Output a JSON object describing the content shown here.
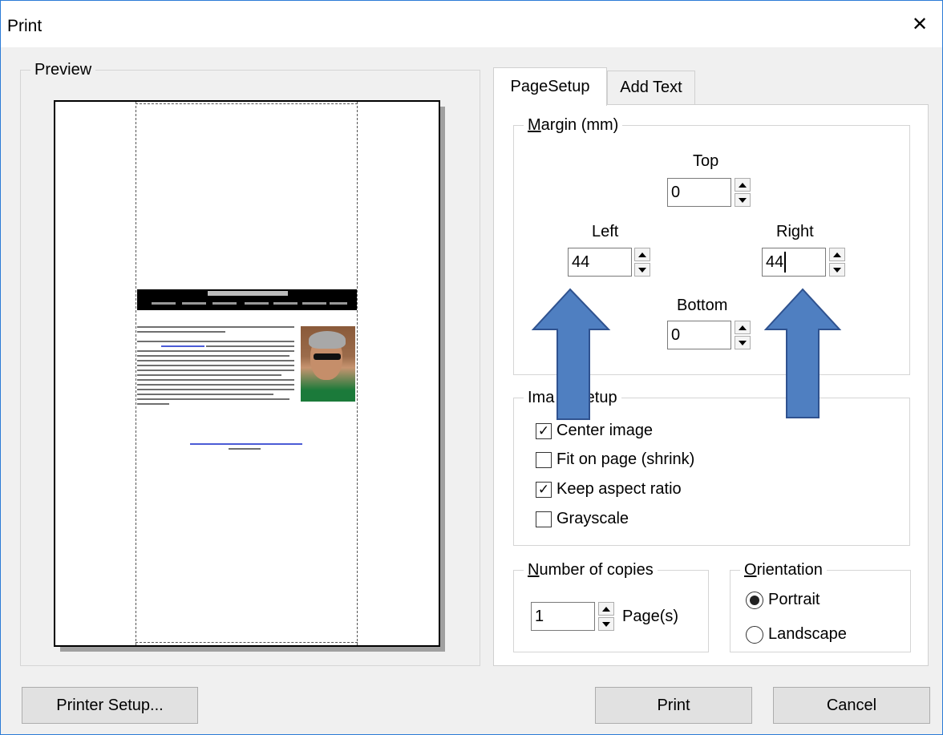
{
  "window": {
    "title": "Print"
  },
  "preview": {
    "legend": "Preview"
  },
  "tabs": [
    {
      "label": "PageSetup",
      "active": true
    },
    {
      "label": "Add Text",
      "active": false
    }
  ],
  "margin": {
    "legend_mnemonic": "M",
    "legend_rest": "argin (mm)",
    "top": {
      "label": "Top",
      "value": "0"
    },
    "left": {
      "label": "Left",
      "value": "44"
    },
    "right": {
      "label": "Right",
      "value": "44"
    },
    "bottom": {
      "label": "Bottom",
      "value": "0"
    }
  },
  "image_setup": {
    "legend_visible": "Ima",
    "legend_rest": "Setup",
    "options": [
      {
        "label": "Center image",
        "checked": true
      },
      {
        "label": "Fit on page (shrink)",
        "checked": false
      },
      {
        "label": "Keep aspect ratio",
        "checked": true
      },
      {
        "label": "Grayscale",
        "checked": false
      }
    ]
  },
  "copies": {
    "legend_mnemonic": "N",
    "legend_rest": "umber of copies",
    "value": "1",
    "unit": "Page(s)"
  },
  "orientation": {
    "legend_mnemonic": "O",
    "legend_rest": "rientation",
    "options": [
      {
        "label": "Portrait",
        "selected": true
      },
      {
        "label": "Landscape",
        "selected": false
      }
    ]
  },
  "buttons": {
    "printer_setup": "Printer Setup...",
    "print": "Print",
    "cancel": "Cancel"
  },
  "glyphs": {
    "close": "✕",
    "check": "✓"
  },
  "colors": {
    "arrow_fill": "#4f7fc1",
    "arrow_stroke": "#2f528f",
    "title_border": "#2b7bd6"
  }
}
